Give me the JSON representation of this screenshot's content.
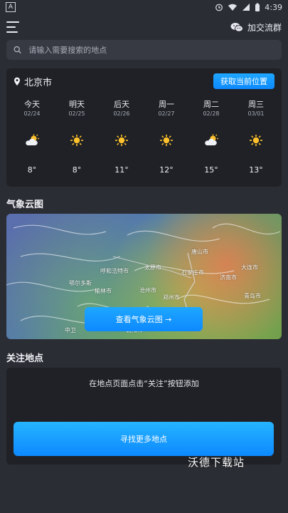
{
  "status_bar": {
    "time": "4:39",
    "app_icon_letter": "A"
  },
  "header": {
    "wechat_label": "加交流群"
  },
  "search": {
    "placeholder": "请输入需要搜索的地点"
  },
  "forecast": {
    "location": "北京市",
    "get_location_label": "获取当前位置",
    "days": [
      {
        "name": "今天",
        "date": "02/24",
        "icon": "cloud-sun-icon",
        "temp": "8°"
      },
      {
        "name": "明天",
        "date": "02/25",
        "icon": "sun-icon",
        "temp": "8°"
      },
      {
        "name": "后天",
        "date": "02/26",
        "icon": "sun-icon",
        "temp": "11°"
      },
      {
        "name": "周一",
        "date": "02/27",
        "icon": "sun-icon",
        "temp": "12°"
      },
      {
        "name": "周二",
        "date": "02/28",
        "icon": "cloud-sun-icon",
        "temp": "15°"
      },
      {
        "name": "周三",
        "date": "03/01",
        "icon": "sun-icon",
        "temp": "13°"
      }
    ]
  },
  "cloud_section": {
    "title": "气象云图",
    "button_label": "查看气象云图 →",
    "map_labels": [
      "呼和浩特市",
      "鄂尔多斯",
      "榆林市",
      "太原市",
      "石家庄市",
      "济南市",
      "郑州市",
      "沧州市",
      "青岛市",
      "中卫",
      "襄阳市",
      "唐山市",
      "大连市"
    ]
  },
  "follow_section": {
    "title": "关注地点",
    "hint": "在地点页面点击“关注”按钮添加",
    "button_label": "寻找更多地点"
  },
  "watermark": "沃德下载站",
  "colors": {
    "accent": "#0d89ff",
    "background": "#2b2d34",
    "card": "#1f2126"
  }
}
